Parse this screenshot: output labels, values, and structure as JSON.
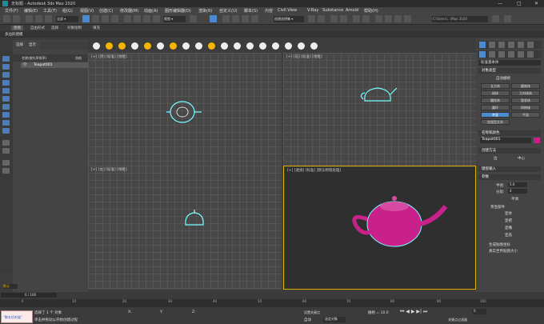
{
  "window": {
    "title": "无标题 - Autodesk 3ds Max 2020"
  },
  "menu": [
    "文件(F)",
    "编辑(E)",
    "工具(T)",
    "组(G)",
    "视图(V)",
    "创建(C)",
    "修改器(M)",
    "动画(A)",
    "图形编辑器(D)",
    "渲染(R)",
    "自定义(U)",
    "脚本(S)",
    "内容",
    "Civil View",
    "V-Ray",
    "Substance",
    "Arnold",
    "帮助(H)"
  ],
  "search": {
    "placeholder": "C:\\Users\\...\\Max 2020"
  },
  "ribbon_tabs": [
    "建模",
    "自由形式",
    "选择",
    "对象绘制",
    "填充"
  ],
  "ribbon2": {
    "label": "多边形建模"
  },
  "scene_explorer": {
    "tabs": [
      "选择",
      "显示"
    ],
    "header": "名称(按升序排序)",
    "col": "冻结",
    "item": "Teapot001"
  },
  "viewports": {
    "top": "[+] [顶] [标准] [线框]",
    "front": "[+] [前] [标准] [线框]",
    "left": "[+] [左] [标准] [线框]",
    "persp": "[+] [透视] [标准] [默认明暗处理]"
  },
  "command_panel": {
    "header": "标准基本体",
    "section1": "对象类型",
    "autogrid": "自动栅格",
    "buttons": [
      "长方体",
      "圆锥体",
      "球体",
      "几何球体",
      "圆柱体",
      "管状体",
      "圆环",
      "四棱锥",
      "茶壶",
      "平面",
      "加强型文本"
    ],
    "section2": "名称和颜色",
    "object_name": "Teapot001",
    "object_color": "#c8228a",
    "section3": "创建方法",
    "radio1": "边",
    "radio2": "中心",
    "section4": "键盘输入",
    "section5": "参数",
    "radius_label": "半径:",
    "radius": "5.0",
    "segments_label": "分段:",
    "segments": "4",
    "smooth": "平滑",
    "parts_label": "茶壶部件",
    "parts": [
      "壶体",
      "壶把",
      "壶嘴",
      "壶盖"
    ],
    "gen_uv": "生成贴图坐标",
    "real_world": "真实世界贴图大小"
  },
  "timeline": {
    "position": "0 / 100",
    "ticks": [
      "0",
      "10",
      "20",
      "30",
      "40",
      "50",
      "60",
      "70",
      "80",
      "90",
      "100"
    ]
  },
  "status": {
    "selected": "选择了 1 个 对象",
    "hint": "单击并拖动以开始创建过程",
    "script": "\"脚本侦听器\"",
    "grid": "栅格 = 10.0",
    "auto": "自动",
    "selection_set": "选定对象",
    "set_key": "设置关键点",
    "key_filter": "关键点过滤器",
    "x_label": "X:",
    "y_label": "Y:",
    "z_label": "Z:",
    "frame": "0",
    "workspace": "默认"
  }
}
